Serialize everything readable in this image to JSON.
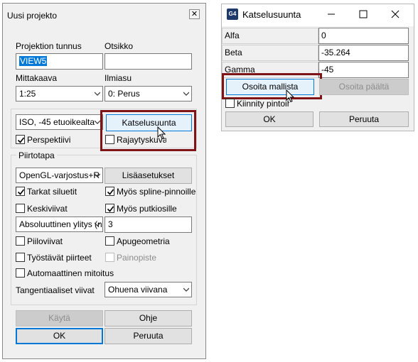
{
  "dialog_main": {
    "title": "Uusi projekto",
    "close_label": "✕",
    "projection_id_label": "Projektion tunnus",
    "projection_id_value": "VIEW5",
    "title_label": "Otsikko",
    "title_value": "",
    "scale_label": "Mittakaava",
    "scale_value": "1:25",
    "appearance_label": "Ilmiasu",
    "appearance_value": "0: Perus",
    "view_direction_value": "ISO, -45 etuoikealta",
    "view_direction_button": "Katselusuunta",
    "perspective_label": "Perspektiivi",
    "perspective_checked": true,
    "boundary_label": "Rajaytyskuvat",
    "boundary_checked": false,
    "drawing_group_label": "Piirtotapa",
    "render_mode_value": "OpenGL-varjostus+R",
    "more_settings_button": "Lisäasetukset",
    "options": {
      "tarkat_siluetit": {
        "label": "Tarkat siluetit",
        "checked": true
      },
      "myos_spline": {
        "label": "Myös spline-pinnoille",
        "checked": true
      },
      "keskiviivat": {
        "label": "Keskiviivat",
        "checked": false
      },
      "myos_putkiosille": {
        "label": "Myös putkiosille",
        "checked": true
      },
      "piiloviivat": {
        "label": "Piiloviivat",
        "checked": false
      },
      "apugeometria": {
        "label": "Apugeometria",
        "checked": false
      },
      "tyostavat_piirteet": {
        "label": "Työstävät piirteet",
        "checked": false
      },
      "painopiste": {
        "label": "Painopiste",
        "checked": false,
        "disabled": true
      },
      "automaattinen_mitoitus": {
        "label": "Automaattinen mitoitus",
        "checked": false
      }
    },
    "overshoot_value": "Absoluuttinen ylitys (n",
    "overshoot_amount": "3",
    "tangent_lines_label": "Tangentiaaliset viivat",
    "tangent_lines_value": "Ohuena viivana",
    "apply_button": "Käytä",
    "help_button": "Ohje",
    "ok_button": "OK",
    "cancel_button": "Peruuta"
  },
  "dialog_view": {
    "app_badge": "G4",
    "title": "Katselusuunta",
    "minimize_icon": "minimize-icon",
    "maximize_icon": "maximize-icon",
    "close_icon": "close-icon",
    "alfa_label": "Alfa",
    "alfa_value": "0",
    "beta_label": "Beta",
    "beta_value": "-35.264",
    "gamma_label": "Gamma",
    "gamma_value": "-45",
    "from_model_button": "Osoita mallista",
    "from_top_button": "Osoita päältä",
    "fixed_faces_label": "Kiinnity pintoihin",
    "ok_button": "OK",
    "cancel_button": "Peruuta"
  },
  "colors": {
    "highlight": "#7f1416",
    "accent": "#0078d7"
  }
}
